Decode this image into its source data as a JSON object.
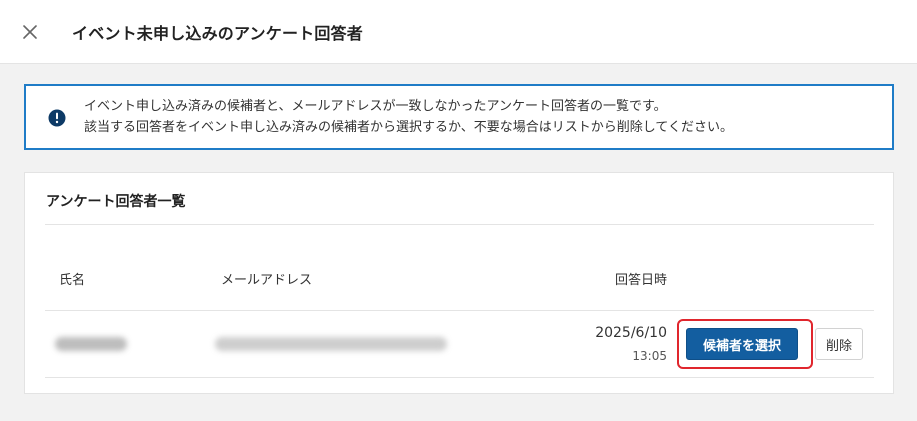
{
  "header": {
    "title": "イベント未申し込みのアンケート回答者",
    "close_icon": "close-icon"
  },
  "notice": {
    "icon": "exclamation-circle-icon",
    "line1": "イベント申し込み済みの候補者と、メールアドレスが一致しなかったアンケート回答者の一覧です。",
    "line2": "該当する回答者をイベント申し込み済みの候補者から選択するか、不要な場合はリストから削除してください。"
  },
  "panel": {
    "title": "アンケート回答者一覧",
    "columns": {
      "name": "氏名",
      "email": "メールアドレス",
      "date": "回答日時"
    },
    "rows": [
      {
        "date": "2025/6/10",
        "time": "13:05",
        "select_label": "候補者を選択",
        "delete_label": "削除"
      }
    ]
  },
  "colors": {
    "accent": "#1f7cc7",
    "primary_button": "#135ea0",
    "highlight": "#e0262d",
    "background": "#f2f2f2"
  }
}
